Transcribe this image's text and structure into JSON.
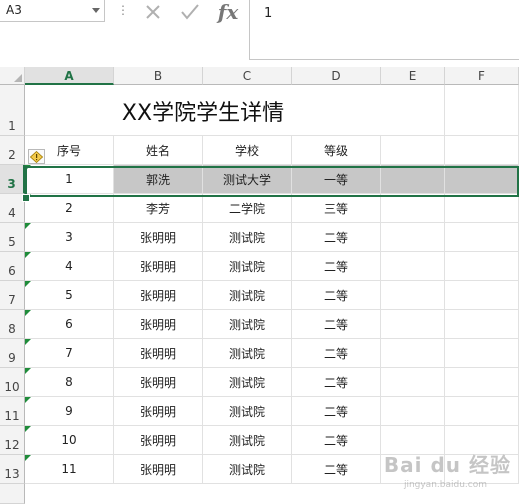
{
  "name_box": {
    "value": "A3"
  },
  "formula_bar": {
    "menu_dots": "⋮",
    "fx": "fx",
    "content": "1"
  },
  "columns": [
    "A",
    "B",
    "C",
    "D",
    "E",
    "F"
  ],
  "active_column": "A",
  "title_row": {
    "row_number": "1",
    "text": "XX学院学生详情"
  },
  "headers": {
    "row_number": "2",
    "cells": [
      "序号",
      "姓名",
      "学校",
      "等级"
    ]
  },
  "rows": [
    {
      "row_number": "3",
      "cells": [
        "1",
        "郭洗",
        "测试大学",
        "一等"
      ],
      "selected": true
    },
    {
      "row_number": "4",
      "cells": [
        "2",
        "李芳",
        "二学院",
        "三等"
      ]
    },
    {
      "row_number": "5",
      "cells": [
        "3",
        "张明明",
        "测试院",
        "二等"
      ]
    },
    {
      "row_number": "6",
      "cells": [
        "4",
        "张明明",
        "测试院",
        "二等"
      ]
    },
    {
      "row_number": "7",
      "cells": [
        "5",
        "张明明",
        "测试院",
        "二等"
      ]
    },
    {
      "row_number": "8",
      "cells": [
        "6",
        "张明明",
        "测试院",
        "二等"
      ]
    },
    {
      "row_number": "9",
      "cells": [
        "7",
        "张明明",
        "测试院",
        "二等"
      ]
    },
    {
      "row_number": "10",
      "cells": [
        "8",
        "张明明",
        "测试院",
        "二等"
      ]
    },
    {
      "row_number": "11",
      "cells": [
        "9",
        "张明明",
        "测试院",
        "二等"
      ]
    },
    {
      "row_number": "12",
      "cells": [
        "10",
        "张明明",
        "测试院",
        "二等"
      ]
    },
    {
      "row_number": "13",
      "cells": [
        "11",
        "张明明",
        "测试院",
        "二等"
      ]
    }
  ],
  "watermark": {
    "text": "Bai du 经验",
    "sub": "jingyan.baidu.com"
  },
  "colors": {
    "accent": "#217346",
    "selected_fill": "#c7c7c7",
    "error_triangle": "#1f8c3a"
  }
}
